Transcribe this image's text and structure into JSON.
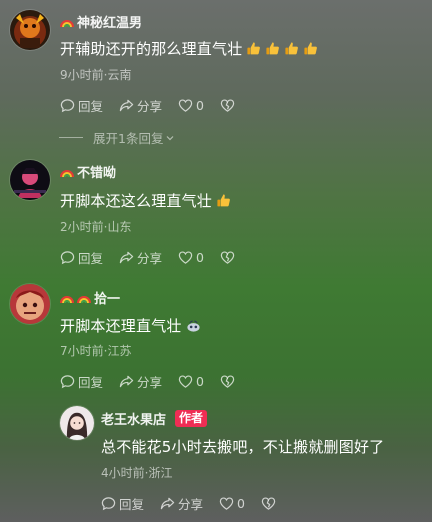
{
  "comments": [
    {
      "username": "神秘红温男",
      "text": "开辅助还开的那么理直气壮",
      "meta": "9小时前·云南",
      "reply_label": "回复",
      "share_label": "分享",
      "like_count": "0",
      "expand_label": "展开1条回复"
    },
    {
      "username": "不错呦",
      "text": "开脚本还这么理直气壮",
      "meta": "2小时前·山东",
      "reply_label": "回复",
      "share_label": "分享",
      "like_count": "0"
    },
    {
      "username": "拾一",
      "text": "开脚本还理直气壮",
      "meta": "7小时前·江苏",
      "reply_label": "回复",
      "share_label": "分享",
      "like_count": "0"
    },
    {
      "username": "老王水果店",
      "badge": "作者",
      "text": "总不能花5小时去搬吧，不让搬就删图好了",
      "meta": "4小时前·浙江",
      "reply_label": "回复",
      "share_label": "分享",
      "like_count": "0"
    }
  ],
  "icons": {
    "reply": "reply-bubble-icon",
    "share": "share-arrow-icon",
    "like": "heart-icon",
    "dislike": "broken-heart-icon",
    "thumbs": "thumbs-up-emoji-icon",
    "rainbow": "rainbow-badge-icon"
  },
  "colors": {
    "author_badge": "#ef2d54",
    "thumb": "#f8c13a"
  }
}
